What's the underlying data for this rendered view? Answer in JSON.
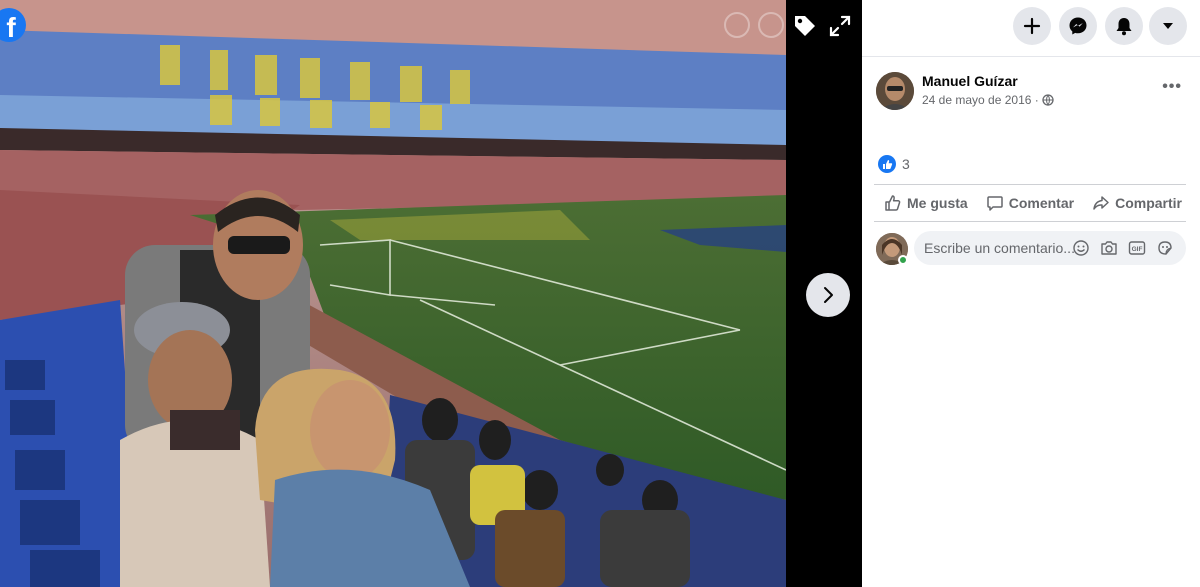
{
  "viewer": {
    "logo_letter": "f",
    "icons": {
      "logo": "facebook-logo-icon",
      "tag": "tag-icon",
      "expand": "expand-icon",
      "next": "chevron-right-icon"
    }
  },
  "topbar": {
    "icons": [
      "plus-icon",
      "messenger-icon",
      "bell-icon",
      "caret-down-icon"
    ]
  },
  "post": {
    "author": "Manuel Guízar",
    "date": "24 de mayo de 2016 ·",
    "privacy_icon": "globe-icon",
    "more_icon": "ellipsis-icon",
    "more_label": "•••",
    "reactions": {
      "icon": "like-icon",
      "count": "3"
    },
    "actions": [
      {
        "label": "Me gusta",
        "icon": "thumbs-up-icon"
      },
      {
        "label": "Comentar",
        "icon": "comment-icon"
      },
      {
        "label": "Compartir",
        "icon": "share-icon"
      }
    ],
    "comment": {
      "placeholder": "Escribe un comentario...",
      "icons": [
        "emoji-icon",
        "camera-icon",
        "gif-icon",
        "sticker-icon"
      ]
    }
  },
  "colors": {
    "brand": "#1877f2",
    "online": "#31a24c",
    "pitch": "#3f6a2e",
    "seats": "#2c4fb0"
  }
}
